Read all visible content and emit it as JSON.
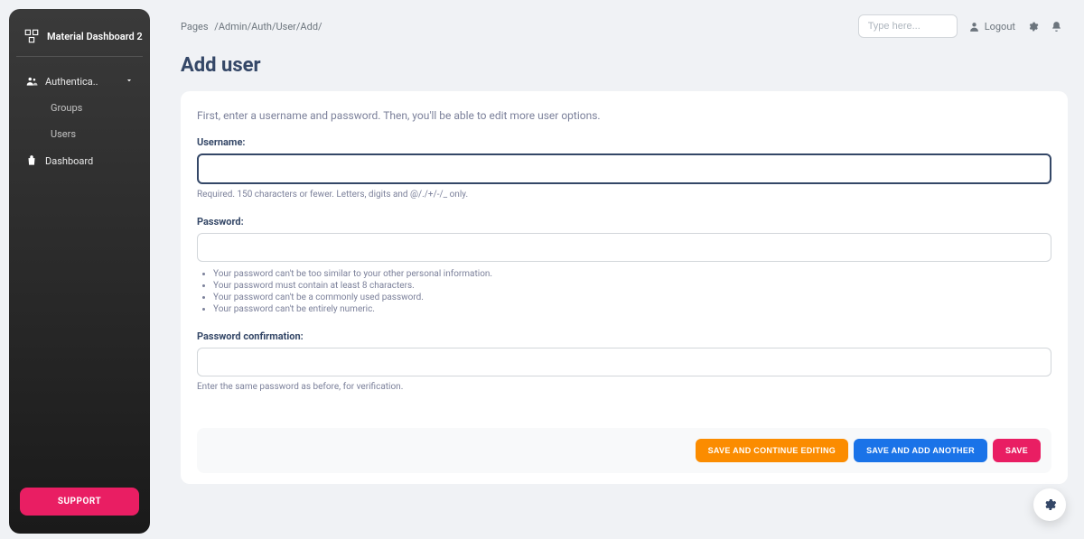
{
  "brand": {
    "title": "Material Dashboard 2"
  },
  "sidebar": {
    "auth_label": "Authentica..",
    "groups_label": "Groups",
    "users_label": "Users",
    "dashboard_label": "Dashboard",
    "support_label": "SUPPORT"
  },
  "topbar": {
    "pages_label": "Pages",
    "breadcrumb_path": "/Admin/Auth/User/Add/",
    "search_placeholder": "Type here...",
    "logout_label": "Logout"
  },
  "page": {
    "title": "Add user",
    "instruction": "First, enter a username and password. Then, you'll be able to edit more user options.",
    "username": {
      "label": "Username:",
      "help": "Required. 150 characters or fewer. Letters, digits and @/./+/-/_ only."
    },
    "password": {
      "label": "Password:",
      "rules": [
        "Your password can't be too similar to your other personal information.",
        "Your password must contain at least 8 characters.",
        "Your password can't be a commonly used password.",
        "Your password can't be entirely numeric."
      ]
    },
    "password2": {
      "label": "Password confirmation:",
      "help": "Enter the same password as before, for verification."
    },
    "actions": {
      "continue": "SAVE AND CONTINUE EDITING",
      "addanother": "SAVE AND ADD ANOTHER",
      "save": "SAVE"
    }
  }
}
